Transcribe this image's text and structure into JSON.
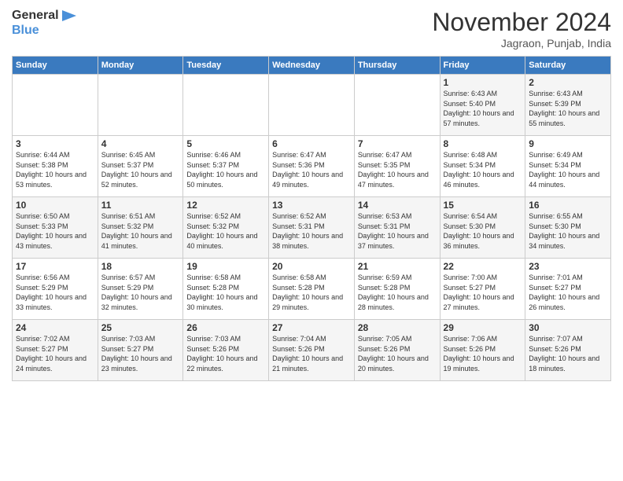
{
  "header": {
    "logo_line1": "General",
    "logo_line2": "Blue",
    "month": "November 2024",
    "location": "Jagraon, Punjab, India"
  },
  "days_of_week": [
    "Sunday",
    "Monday",
    "Tuesday",
    "Wednesday",
    "Thursday",
    "Friday",
    "Saturday"
  ],
  "weeks": [
    [
      {
        "day": "",
        "info": ""
      },
      {
        "day": "",
        "info": ""
      },
      {
        "day": "",
        "info": ""
      },
      {
        "day": "",
        "info": ""
      },
      {
        "day": "",
        "info": ""
      },
      {
        "day": "1",
        "info": "Sunrise: 6:43 AM\nSunset: 5:40 PM\nDaylight: 10 hours and 57 minutes."
      },
      {
        "day": "2",
        "info": "Sunrise: 6:43 AM\nSunset: 5:39 PM\nDaylight: 10 hours and 55 minutes."
      }
    ],
    [
      {
        "day": "3",
        "info": "Sunrise: 6:44 AM\nSunset: 5:38 PM\nDaylight: 10 hours and 53 minutes."
      },
      {
        "day": "4",
        "info": "Sunrise: 6:45 AM\nSunset: 5:37 PM\nDaylight: 10 hours and 52 minutes."
      },
      {
        "day": "5",
        "info": "Sunrise: 6:46 AM\nSunset: 5:37 PM\nDaylight: 10 hours and 50 minutes."
      },
      {
        "day": "6",
        "info": "Sunrise: 6:47 AM\nSunset: 5:36 PM\nDaylight: 10 hours and 49 minutes."
      },
      {
        "day": "7",
        "info": "Sunrise: 6:47 AM\nSunset: 5:35 PM\nDaylight: 10 hours and 47 minutes."
      },
      {
        "day": "8",
        "info": "Sunrise: 6:48 AM\nSunset: 5:34 PM\nDaylight: 10 hours and 46 minutes."
      },
      {
        "day": "9",
        "info": "Sunrise: 6:49 AM\nSunset: 5:34 PM\nDaylight: 10 hours and 44 minutes."
      }
    ],
    [
      {
        "day": "10",
        "info": "Sunrise: 6:50 AM\nSunset: 5:33 PM\nDaylight: 10 hours and 43 minutes."
      },
      {
        "day": "11",
        "info": "Sunrise: 6:51 AM\nSunset: 5:32 PM\nDaylight: 10 hours and 41 minutes."
      },
      {
        "day": "12",
        "info": "Sunrise: 6:52 AM\nSunset: 5:32 PM\nDaylight: 10 hours and 40 minutes."
      },
      {
        "day": "13",
        "info": "Sunrise: 6:52 AM\nSunset: 5:31 PM\nDaylight: 10 hours and 38 minutes."
      },
      {
        "day": "14",
        "info": "Sunrise: 6:53 AM\nSunset: 5:31 PM\nDaylight: 10 hours and 37 minutes."
      },
      {
        "day": "15",
        "info": "Sunrise: 6:54 AM\nSunset: 5:30 PM\nDaylight: 10 hours and 36 minutes."
      },
      {
        "day": "16",
        "info": "Sunrise: 6:55 AM\nSunset: 5:30 PM\nDaylight: 10 hours and 34 minutes."
      }
    ],
    [
      {
        "day": "17",
        "info": "Sunrise: 6:56 AM\nSunset: 5:29 PM\nDaylight: 10 hours and 33 minutes."
      },
      {
        "day": "18",
        "info": "Sunrise: 6:57 AM\nSunset: 5:29 PM\nDaylight: 10 hours and 32 minutes."
      },
      {
        "day": "19",
        "info": "Sunrise: 6:58 AM\nSunset: 5:28 PM\nDaylight: 10 hours and 30 minutes."
      },
      {
        "day": "20",
        "info": "Sunrise: 6:58 AM\nSunset: 5:28 PM\nDaylight: 10 hours and 29 minutes."
      },
      {
        "day": "21",
        "info": "Sunrise: 6:59 AM\nSunset: 5:28 PM\nDaylight: 10 hours and 28 minutes."
      },
      {
        "day": "22",
        "info": "Sunrise: 7:00 AM\nSunset: 5:27 PM\nDaylight: 10 hours and 27 minutes."
      },
      {
        "day": "23",
        "info": "Sunrise: 7:01 AM\nSunset: 5:27 PM\nDaylight: 10 hours and 26 minutes."
      }
    ],
    [
      {
        "day": "24",
        "info": "Sunrise: 7:02 AM\nSunset: 5:27 PM\nDaylight: 10 hours and 24 minutes."
      },
      {
        "day": "25",
        "info": "Sunrise: 7:03 AM\nSunset: 5:27 PM\nDaylight: 10 hours and 23 minutes."
      },
      {
        "day": "26",
        "info": "Sunrise: 7:03 AM\nSunset: 5:26 PM\nDaylight: 10 hours and 22 minutes."
      },
      {
        "day": "27",
        "info": "Sunrise: 7:04 AM\nSunset: 5:26 PM\nDaylight: 10 hours and 21 minutes."
      },
      {
        "day": "28",
        "info": "Sunrise: 7:05 AM\nSunset: 5:26 PM\nDaylight: 10 hours and 20 minutes."
      },
      {
        "day": "29",
        "info": "Sunrise: 7:06 AM\nSunset: 5:26 PM\nDaylight: 10 hours and 19 minutes."
      },
      {
        "day": "30",
        "info": "Sunrise: 7:07 AM\nSunset: 5:26 PM\nDaylight: 10 hours and 18 minutes."
      }
    ]
  ]
}
